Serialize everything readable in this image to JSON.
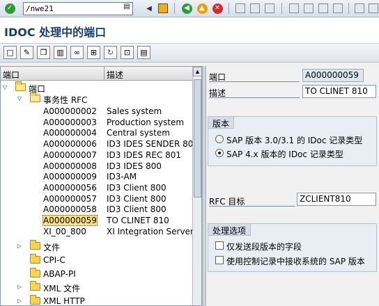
{
  "command_field": {
    "value": "/nwe21"
  },
  "title": "IDOC 处理中的端口",
  "colors": {
    "title": "#1a3e6e",
    "selection": "#ffe270",
    "folder": "#f6d453"
  },
  "tree": {
    "headers": {
      "col1": "端口",
      "col2": "描述"
    },
    "root": "端口",
    "transactional_rfc": "事务性 RFC",
    "ports": [
      {
        "id": "A000000002",
        "desc": "Sales system"
      },
      {
        "id": "A000000003",
        "desc": "Production system"
      },
      {
        "id": "A000000004",
        "desc": "Central system"
      },
      {
        "id": "A000000006",
        "desc": "ID3 IDES SENDER 802"
      },
      {
        "id": "A000000007",
        "desc": "ID3 IDES REC 801"
      },
      {
        "id": "A000000008",
        "desc": "ID3 IDES 800"
      },
      {
        "id": "A000000009",
        "desc": "ID3-AM"
      },
      {
        "id": "A000000056",
        "desc": "ID3 Client 800"
      },
      {
        "id": "A000000057",
        "desc": "ID3 Client 800"
      },
      {
        "id": "A000000058",
        "desc": "ID3 Client 800"
      },
      {
        "id": "A000000059",
        "desc": "TO CLINET 810"
      },
      {
        "id": "XI_00_800",
        "desc": "XI  Integration Server"
      }
    ],
    "other_folders": [
      {
        "label": "文件"
      },
      {
        "label": "CPI-C"
      },
      {
        "label": "ABAP-PI"
      },
      {
        "label": "XML 文件"
      },
      {
        "label": "XML HTTP"
      }
    ]
  },
  "detail": {
    "port_label": "端口",
    "port_value": "A000000059",
    "desc_label": "描述",
    "desc_value": "TO CLINET 810",
    "version_group": "版本",
    "version_opt1": "SAP 版本 3.0/3.1 的 IDoc 记录类型",
    "version_opt2": "SAP 4.x 版本的 IDoc 记录类型",
    "rfc_label": "RFC 目标",
    "rfc_value": "ZCLIENT810",
    "processing_group": "处理选项",
    "proc_opt1": "仅发送段版本的字段",
    "proc_opt2": "使用控制记录中接收系统的 SAP 版本"
  }
}
